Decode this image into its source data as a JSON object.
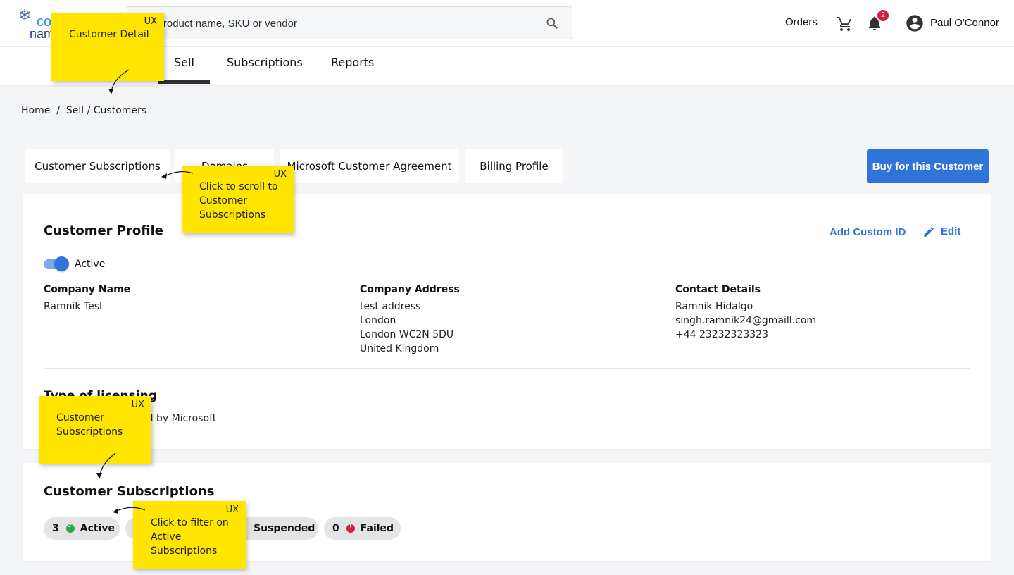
{
  "header": {
    "logo_line1": "co",
    "logo_line2": "nam",
    "search_placeholder": "h by product name, SKU or vendor",
    "orders_label": "Orders",
    "notification_count": "2",
    "user_name": "Paul O'Connor"
  },
  "main_tabs": [
    "Sell",
    "Subscriptions",
    "Reports"
  ],
  "breadcrumb": "Home  /  Sell / Customers",
  "section_tabs": [
    "Customer Subscriptions",
    "Domains",
    "Microsoft Customer Agreement",
    "Billing Profile"
  ],
  "buy_button": "Buy for this Customer",
  "profile": {
    "title": "Customer Profile",
    "add_custom_id": "Add Custom ID",
    "edit": "Edit",
    "status": "Active",
    "company_name_label": "Company Name",
    "company_name": "Ramnik Test",
    "address_label": "Company Address",
    "address_lines": [
      "test address",
      "London",
      "London WC2N 5DU",
      "United Kingdom"
    ],
    "contact_label": "Contact Details",
    "contact_lines": [
      "Ramnik Hidalgo",
      "singh.ramnik24@gmaill.com",
      "+44 23232323323"
    ],
    "licensing_title": "Type of licensing",
    "licensing_value": "ed by Microsoft"
  },
  "subscriptions": {
    "title": "Customer Subscriptions",
    "filters": [
      {
        "count": "3",
        "label": "Active"
      },
      {
        "count": "",
        "label": "Suspended"
      },
      {
        "count": "0",
        "label": "Failed"
      }
    ]
  },
  "notes": {
    "tag": "UX",
    "customer_detail": "Customer Detail",
    "scroll": "Click to scroll to Customer Subscriptions",
    "subs": "Customer Subscriptions",
    "filter": "Click to filter on Active Subscriptions"
  },
  "colors": {
    "accent": "#2f74d9",
    "note": "#ffe500",
    "active_green": "#2ea44f",
    "failed_red": "#d21f3c"
  }
}
